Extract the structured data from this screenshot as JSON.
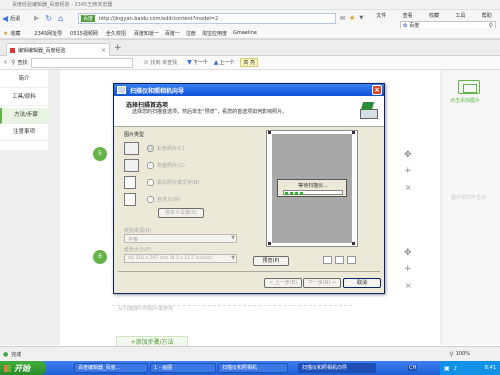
{
  "browser": {
    "window_title": "百度经验编辑器_百度经验 - 2345王牌浏览器",
    "menu": [
      "文件",
      "查看",
      "收藏",
      "工具",
      "帮助"
    ],
    "nav_back": "后退",
    "address_badge": "百度",
    "url": "http://jingyan.baidu.com/edit/content?model=2",
    "search_engine": "百度",
    "bookmarks": [
      "收藏",
      "2345网址导",
      "0515视频网",
      "全久校招",
      "百度知道一",
      "百度一",
      "注册",
      "淘宝应用度",
      "Gmaeline"
    ],
    "tab_label": "编辑编辑器_百度经验",
    "new_tab": "+"
  },
  "editbar": {
    "search_label": "查找",
    "find_placeholder": "",
    "options": [
      "匹配大小写",
      "标记"
    ],
    "not_found": "找到 未查找",
    "next": "下一个",
    "prev": "上一个",
    "highlight": "高 亮"
  },
  "leftnav": {
    "items": [
      "简介",
      "工具/原料",
      "方法/步骤",
      "注意事项"
    ]
  },
  "steps": {
    "step5": "5",
    "step6": "6",
    "add_step": "+添加步骤/方法",
    "caption": "从扫描器中的图片或使用"
  },
  "rightcol": {
    "add_image": "点击添加图片",
    "image_hint": "图片暂时不显示"
  },
  "dialog": {
    "title": "扫描仪和照相机向导",
    "header_title": "选择扫描首选项",
    "header_sub": "选择您的扫描首选项，然后单击“预览”，看您的首选项如何影响照片。",
    "picture_type_label": "图片类型",
    "types": [
      "彩色照片(C)",
      "灰度照片(G)",
      "黑白照片或文字(B)",
      "自定义(M)"
    ],
    "custom_settings": "自定义设置(S)",
    "paper_source_label": "纸张来源(R)",
    "paper_source_value": "平板",
    "paper_size_label": "纸张大小(P)",
    "paper_size_value": "A4 210 x 297 mm (8.3 x 11.7 inches)",
    "preview_btn": "预览(P)",
    "scanning_text": "等待扫描仪...",
    "back_btn": "< 上一步(B)",
    "next_btn": "下一步(N) >",
    "cancel_btn": "取消"
  },
  "statusbar": {
    "status_text": "完成",
    "zoom": "100%"
  },
  "taskbar": {
    "start": "开始",
    "tasks": [
      "百度编辑器_百度...",
      "1 - 画图",
      "扫描仪和照相机",
      "扫描仪和照相机向导"
    ],
    "lang": "CH",
    "clock": "8:41"
  },
  "colors": {
    "accent_green": "#64b447",
    "title_blue": "#0b53d6"
  }
}
